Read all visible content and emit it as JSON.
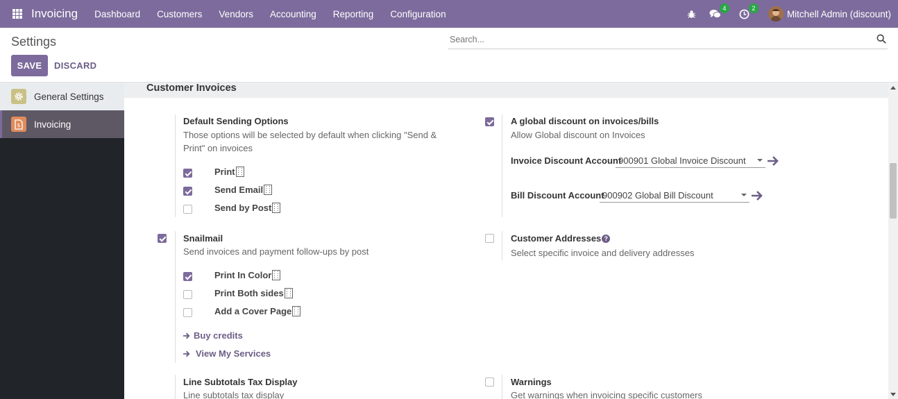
{
  "navbar": {
    "app_name": "Invoicing",
    "menu": [
      "Dashboard",
      "Customers",
      "Vendors",
      "Accounting",
      "Reporting",
      "Configuration"
    ],
    "messages_count": "4",
    "activities_count": "2",
    "user_name": "Mitchell Admin (discount)"
  },
  "control_panel": {
    "title": "Settings",
    "save_label": "SAVE",
    "discard_label": "DISCARD",
    "search_placeholder": "Search..."
  },
  "sidebar": {
    "items": [
      {
        "label": "General Settings",
        "icon": "gear-icon"
      },
      {
        "label": "Invoicing",
        "icon": "invoice-icon"
      }
    ]
  },
  "section": {
    "title": "Customer Invoices"
  },
  "settings": {
    "default_sending": {
      "title": "Default Sending Options",
      "desc_line1": "Those options will be selected by default when clicking \"Send &",
      "desc_line2": "Print\" on invoices",
      "options": [
        {
          "label": "Print",
          "checked": true
        },
        {
          "label": "Send Email",
          "checked": true
        },
        {
          "label": "Send by Post",
          "checked": false
        }
      ]
    },
    "global_discount": {
      "title": "A global discount on invoices/bills",
      "desc": "Allow Global discount on Invoices",
      "checked": true,
      "invoice_account_label": "Invoice Discount Account",
      "invoice_account_value": "900901 Global Invoice Discount",
      "bill_account_label": "Bill Discount Account",
      "bill_account_value": "900902 Global Bill Discount"
    },
    "snailmail": {
      "title": "Snailmail",
      "desc": "Send invoices and payment follow-ups by post",
      "checked": true,
      "options": [
        {
          "label": "Print In Color",
          "checked": true
        },
        {
          "label": "Print Both sides",
          "checked": false
        },
        {
          "label": "Add a Cover Page",
          "checked": false
        }
      ],
      "buy_credits": "Buy credits",
      "view_services": "View My Services"
    },
    "customer_addresses": {
      "title": "Customer Addresses",
      "desc": "Select specific invoice and delivery addresses",
      "checked": false
    },
    "line_subtotals": {
      "title": "Line Subtotals Tax Display",
      "desc": "Line subtotals tax display"
    },
    "warnings": {
      "title": "Warnings",
      "desc": "Get warnings when invoicing specific customers",
      "checked": false
    }
  },
  "colors": {
    "brand": "#7c6b9c",
    "sidebar_bg": "#212529",
    "badge": "#28a745"
  }
}
